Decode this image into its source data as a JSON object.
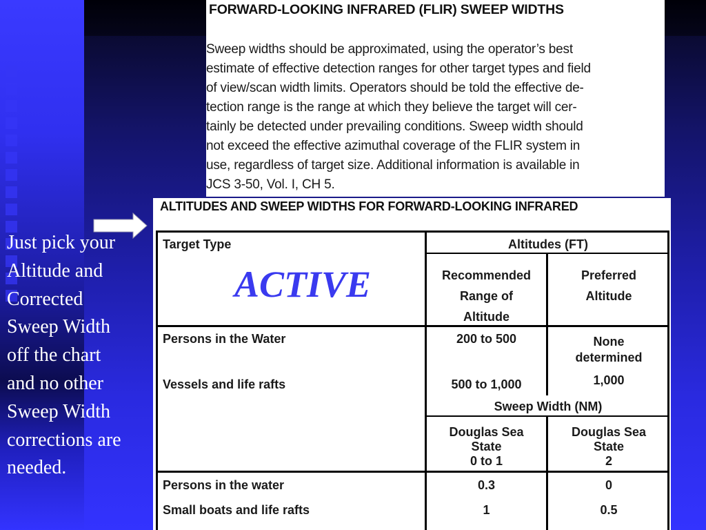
{
  "slide": {
    "caption_lines": [
      "Just pick your",
      "Altitude and",
      "Corrected",
      "Sweep Width",
      "off the chart",
      "and no other",
      "Sweep Width",
      "corrections are",
      "needed."
    ],
    "pointer_icon": "right-arrow-icon",
    "colors": {
      "background": "#1e1ea8",
      "caption_text": "#ffffff",
      "highlight_text": "#3a3aef"
    }
  },
  "flir_excerpt": {
    "title": "FORWARD-LOOKING INFRARED (FLIR) SWEEP WIDTHS",
    "body_lines": [
      "Sweep widths should be approximated, using the operator’s best",
      "estimate of effective detection ranges for other target types and field",
      "of view/scan width limits. Operators should be told the effective de-",
      "tection range is the range at which they believe the target will cer-",
      "tainly be detected under prevailing conditions. Sweep width should",
      "not exceed the effective azimuthal coverage of the FLIR system in",
      "use, regardless of target size. Additional information is available in",
      "JCS 3-50, Vol. I, CH 5."
    ]
  },
  "table": {
    "title": "ALTITUDES AND SWEEP WIDTHS FOR FORWARD-LOOKING INFRARED",
    "target_type_header": "Target Type",
    "highlight_label": "ACTIVE",
    "altitudes_header": "Altitudes (FT)",
    "recommended_header": [
      "Recommended",
      "Range of",
      "Altitude"
    ],
    "preferred_header": [
      "Preferred",
      "Altitude"
    ],
    "altitude_rows": [
      {
        "target": "Persons in the Water",
        "recommended": "200 to 500",
        "preferred": [
          "None",
          "determined"
        ]
      },
      {
        "target": "Vessels and life rafts",
        "recommended": "500 to 1,000",
        "preferred": [
          "1,000"
        ]
      }
    ],
    "sweep_header": "Sweep Width (NM)",
    "sea_state_headers": [
      [
        "Douglas Sea",
        "State",
        "0 to 1"
      ],
      [
        "Douglas Sea",
        "State",
        "2"
      ]
    ],
    "sweep_rows": [
      {
        "target": "Persons in the water",
        "ss_0_1": "0.3",
        "ss_2": "0"
      },
      {
        "target": "Small boats and life rafts",
        "ss_0_1": "1",
        "ss_2": "0.5"
      }
    ]
  }
}
